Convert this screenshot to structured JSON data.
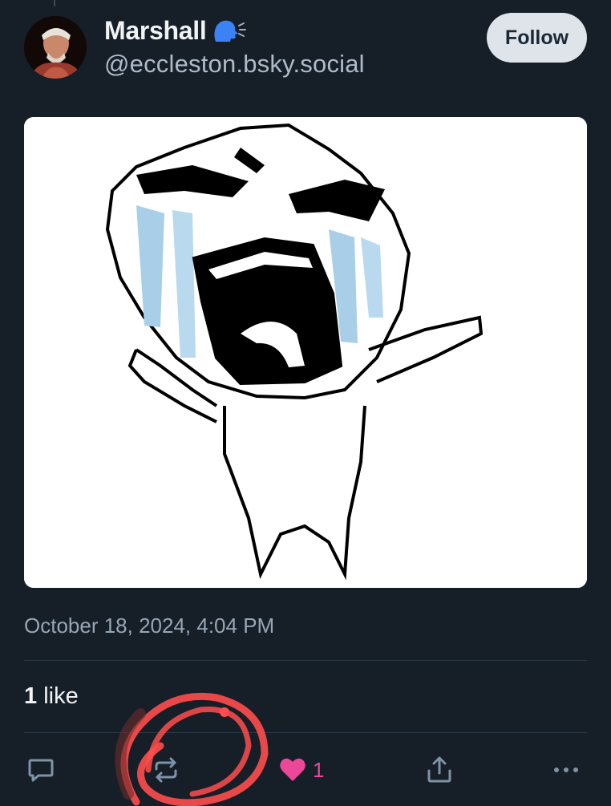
{
  "post": {
    "author": {
      "display_name": "Marshall",
      "name_emoji": "speaking-head-icon",
      "handle": "@eccleston.bsky.social"
    },
    "follow_label": "Follow",
    "media": {
      "description_icon": "crying-rage-face-image"
    },
    "timestamp": "October 18, 2024, 4:04 PM",
    "engagement": {
      "like_count": "1",
      "like_word": "like"
    },
    "actions": {
      "reply_icon": "reply-icon",
      "repost_icon": "repost-icon",
      "like_icon": "heart-icon",
      "like_count": "1",
      "share_icon": "share-icon",
      "more_icon": "more-icon"
    }
  },
  "colors": {
    "background": "#161e27",
    "text_primary": "#f1f3f5",
    "text_secondary": "#aebbc9",
    "like_pink": "#ec4899",
    "follow_bg": "#dfe4ea",
    "scribble_red": "#ff4d4d"
  }
}
